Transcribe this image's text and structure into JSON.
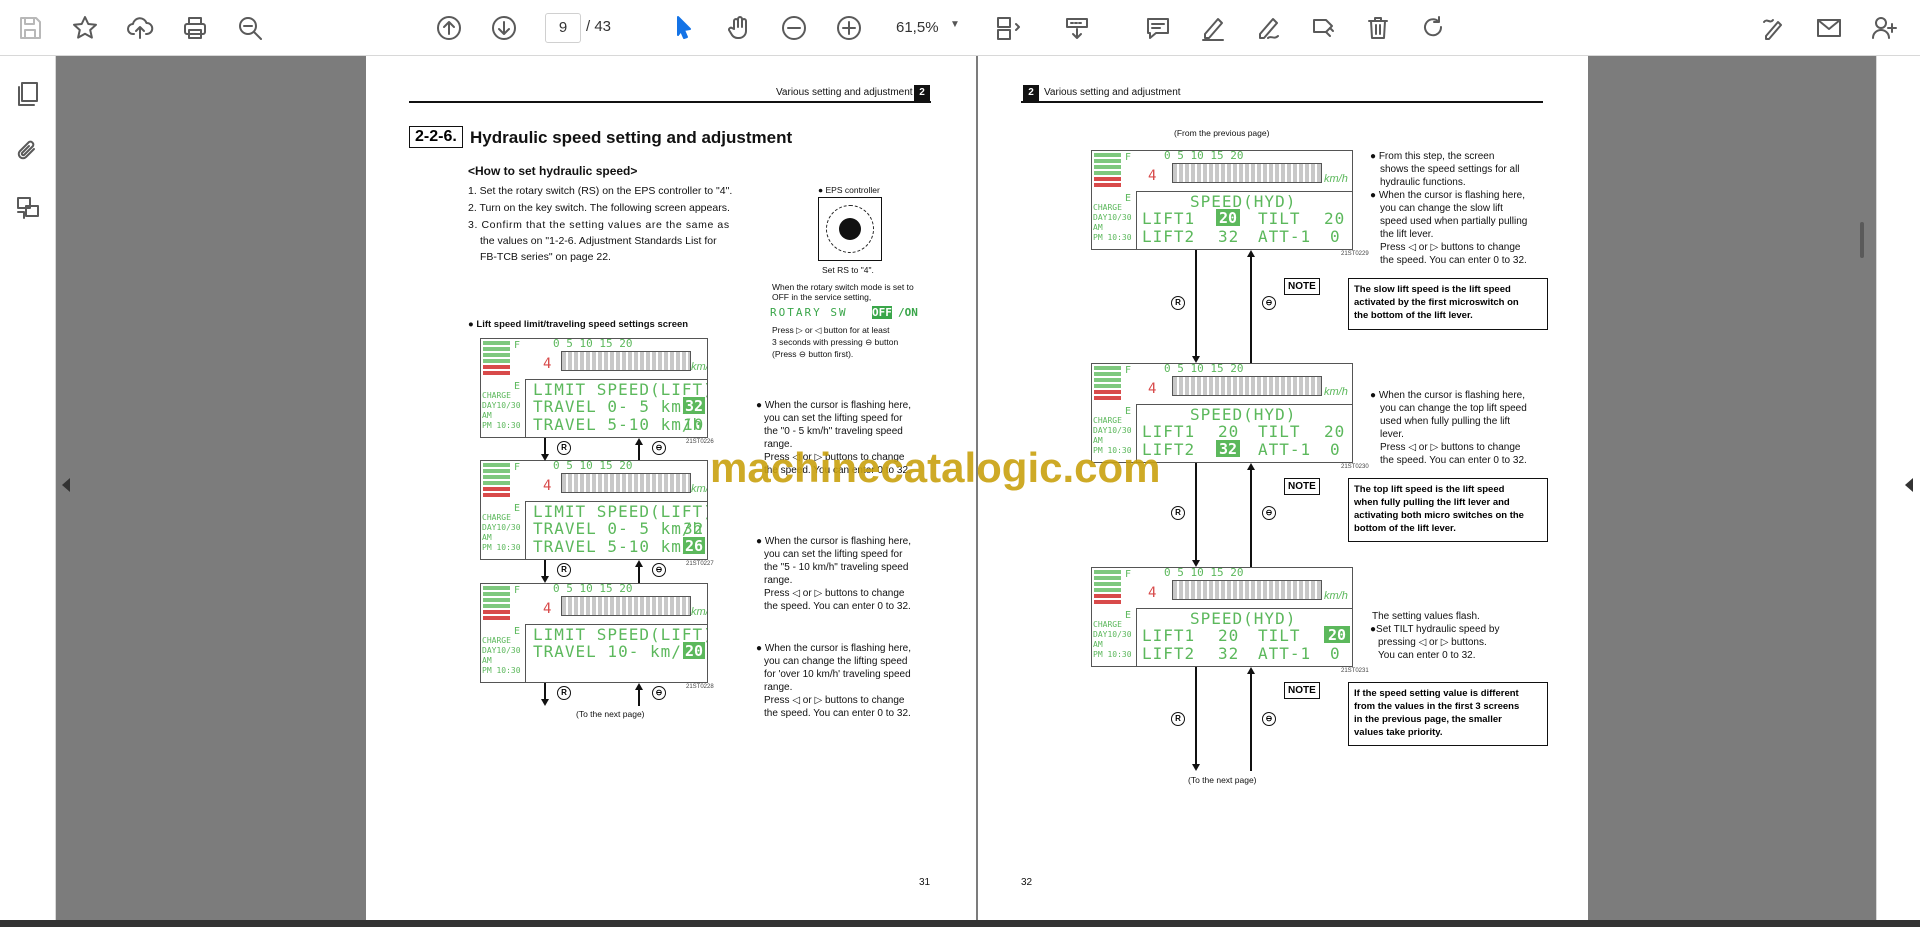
{
  "toolbar": {
    "page_current": "9",
    "page_total": "/ 43",
    "zoom": "61,5%"
  },
  "page31": {
    "header_text": "Various setting and adjustment",
    "header_badge": "2",
    "section_num": "2-2-6.",
    "section_title": "Hydraulic speed setting and adjustment",
    "sub_heading": "<How to set hydraulic speed>",
    "steps": [
      "1. Set the rotary switch (RS) on the EPS controller to \"4\".",
      "2. Turn on the key switch. The following screen appears.",
      "3. Confirm that the setting values are the same as",
      "the values on \"1-2-6. Adjustment Standards List for",
      "FB-TCB series\" on page 22."
    ],
    "eps_label": "EPS controller",
    "rs_caption": "Set RS to \"4\".",
    "rotary_note_1": "When the rotary switch mode is set to",
    "rotary_note_2": "OFF in the service setting,",
    "rotary_sw_text": "ROTARY SW",
    "rotary_off": "OFF",
    "rotary_on": "/ON",
    "press_1": "Press ▷ or ◁ button for at least",
    "press_2": "3 seconds with pressing ⊖ button",
    "press_3": "(Press ⊖ button first).",
    "screen_caption": "Lift speed limit/traveling speed settings screen",
    "lcd_scale": "0    5    10   15   20",
    "lcd_unit": "km/h",
    "lcd_gear": "4",
    "lcd_side": [
      "CHARGE",
      "DAY10/30",
      "AM",
      "PM 10:30"
    ],
    "screens": [
      {
        "line1": "LIMIT SPEED(LIFT)",
        "line2": "TRAVEL  0- 5 km/h",
        "line2_val": "32",
        "line3": "TRAVEL  5-10 km/h",
        "line3_val": "10",
        "fig": "21ST0226"
      },
      {
        "line1": "LIMIT SPEED(LIFT)",
        "line2": "TRAVEL  0- 5 km/h",
        "line2_val": "32",
        "line3": "TRAVEL  5-10 km/h",
        "line3_val": "26",
        "fig": "21ST0227"
      },
      {
        "line1": "LIMIT SPEED(LIFT)",
        "line2": "TRAVEL 10-   km/h",
        "line2_val": "20",
        "line3": "",
        "line3_val": "",
        "fig": "21ST0228"
      }
    ],
    "desc1": [
      "When the cursor is flashing here,",
      "you can set the lifting speed for",
      "the \"0 - 5 km/h\" traveling speed",
      "range.",
      "Press ◁ or ▷ buttons to change",
      "the speed. You can enter 0 to 32."
    ],
    "desc2": [
      "When the cursor is flashing here,",
      "you can set the lifting speed for",
      "the \"5 - 10 km/h\" traveling speed",
      "range.",
      "Press ◁ or ▷ buttons to change",
      "the speed. You can enter 0 to 32."
    ],
    "desc3": [
      "When the cursor is flashing here,",
      "you can change the lifting speed",
      "for 'over 10 km/h' traveling speed",
      "range.",
      "Press ◁ or ▷ buttons to change",
      "the speed. You can enter 0 to 32."
    ],
    "next_page": "(To the next page)",
    "page_number": "31"
  },
  "page32": {
    "header_text": "Various setting and adjustment",
    "header_badge": "2",
    "from_prev": "(From the previous page)",
    "screens": [
      {
        "line1": "SPEED(HYD)",
        "line2a": "LIFT1",
        "line2v": "20",
        "line2b": "TILT",
        "line2w": "20",
        "line3a": "LIFT2",
        "line3v": "32",
        "line3b": "ATT-1",
        "line3w": "0",
        "fig": "21ST0229"
      },
      {
        "line1": "SPEED(HYD)",
        "line2a": "LIFT1",
        "line2v": "20",
        "line2b": "TILT",
        "line2w": "20",
        "line3a": "LIFT2",
        "line3v": "32",
        "line3b": "ATT-1",
        "line3w": "0",
        "fig": "21ST0230"
      },
      {
        "line1": "SPEED(HYD)",
        "line2a": "LIFT1",
        "line2v": "20",
        "line2b": "TILT",
        "line2w": "20",
        "line3a": "LIFT2",
        "line3v": "32",
        "line3b": "ATT-1",
        "line3w": "0",
        "fig": "21ST0231"
      }
    ],
    "lcd_gear": "4",
    "desc1": [
      "From this step, the screen",
      "shows the speed settings for all",
      "hydraulic functions.",
      "When the cursor is flashing here,",
      "you can change the slow lift",
      "speed used when partially pulling",
      "the lift lever.",
      "Press ◁ or ▷ buttons to change",
      "the speed. You can enter 0 to 32."
    ],
    "note_label": "NOTE",
    "note1": [
      "The slow lift speed is the lift speed",
      "activated by the first microswitch on",
      "the bottom of the lift lever."
    ],
    "desc2": [
      "When the cursor is flashing here,",
      "you can change the top lift speed",
      "used when fully pulling the lift",
      "lever.",
      "Press ◁ or ▷ buttons to change",
      "the speed. You can enter 0 to 32."
    ],
    "note2": [
      "The top lift speed is the lift speed",
      "when fully pulling the lift lever and",
      "activating both micro switches on the",
      "bottom of the lift lever."
    ],
    "desc3": [
      "The setting values flash.",
      "●Set TILT hydraulic speed by",
      "pressing ◁ or ▷ buttons.",
      "You can enter 0 to 32."
    ],
    "note3": [
      "If the speed setting value is different",
      "from the values in the first 3 screens",
      "in the previous page, the smaller",
      "values take priority."
    ],
    "next_page": "(To the next page)",
    "page_number": "32"
  },
  "watermark": "machinecatalogic.com"
}
